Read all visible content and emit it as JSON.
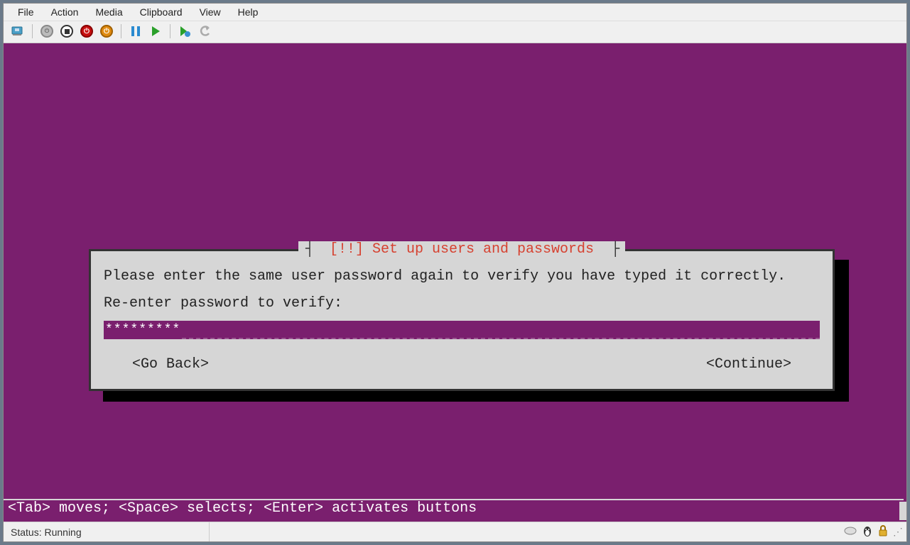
{
  "menu": {
    "items": [
      "File",
      "Action",
      "Media",
      "Clipboard",
      "View",
      "Help"
    ]
  },
  "toolbar": {
    "icons": [
      "connect",
      "ctrl-alt-del",
      "stop",
      "shutdown",
      "power",
      "pause",
      "start",
      "checkpoint",
      "revert"
    ]
  },
  "dialog": {
    "title_bracket_left": "┤",
    "title_prefix": "[!!]",
    "title_text": "Set up users and passwords",
    "title_bracket_right": "├",
    "instruction": "Please enter the same user password again to verify you have typed it correctly.",
    "prompt": "Re-enter password to verify:",
    "masked_value": "*********",
    "go_back": "<Go Back>",
    "continue": "<Continue>"
  },
  "hint": "<Tab> moves; <Space> selects; <Enter> activates buttons",
  "status": {
    "text": "Status: Running"
  }
}
